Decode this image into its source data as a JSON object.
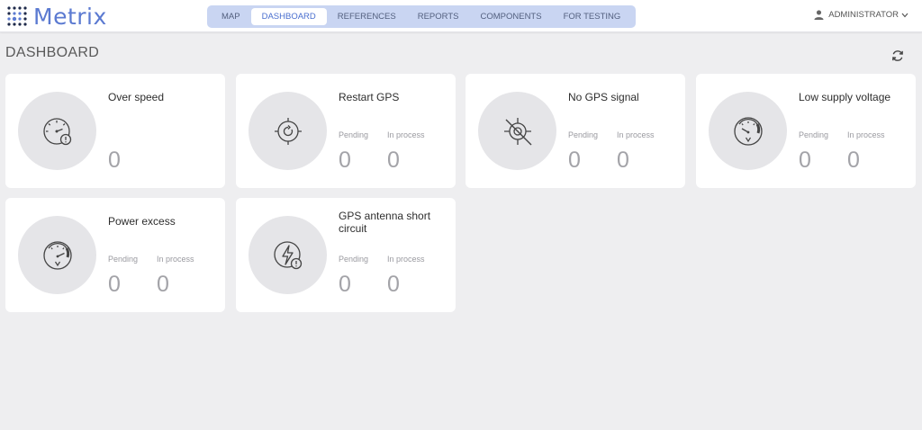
{
  "app": {
    "logo_text": "Metrix"
  },
  "nav": {
    "items": [
      {
        "label": "MAP",
        "active": false
      },
      {
        "label": "DASHBOARD",
        "active": true
      },
      {
        "label": "REFERENCES",
        "active": false
      },
      {
        "label": "REPORTS",
        "active": false
      },
      {
        "label": "COMPONENTS",
        "active": false
      },
      {
        "label": "FOR TESTING",
        "active": false
      }
    ]
  },
  "user": {
    "name": "ADMINISTRATOR",
    "icon": "user-icon"
  },
  "page": {
    "title": "DASHBOARD",
    "refresh_icon": "refresh-icon"
  },
  "cards": [
    {
      "title": "Over speed",
      "icon": "speedometer-alert-icon",
      "count": "0"
    },
    {
      "title": "Restart GPS",
      "icon": "gps-restart-icon",
      "pending_label": "Pending",
      "pending": "0",
      "in_process_label": "In process",
      "in_process": "0"
    },
    {
      "title": "No GPS signal",
      "icon": "no-gps-signal-icon",
      "pending_label": "Pending",
      "pending": "0",
      "in_process_label": "In process",
      "in_process": "0"
    },
    {
      "title": "Low supply voltage",
      "icon": "voltmeter-low-icon",
      "pending_label": "Pending",
      "pending": "0",
      "in_process_label": "In process",
      "in_process": "0"
    },
    {
      "title": "Power excess",
      "icon": "voltmeter-high-icon",
      "pending_label": "Pending",
      "pending": "0",
      "in_process_label": "In process",
      "in_process": "0"
    },
    {
      "title": "GPS antenna short circuit",
      "icon": "lightning-alert-icon",
      "pending_label": "Pending",
      "pending": "0",
      "in_process_label": "In process",
      "in_process": "0"
    }
  ],
  "colors": {
    "accent": "#5b7ad1",
    "nav_bg": "#c9d5f2",
    "page_bg": "#eeeef0"
  }
}
